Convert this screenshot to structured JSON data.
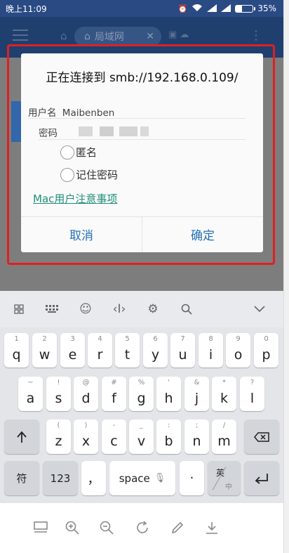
{
  "status_bar": {
    "time": "晚上11:09",
    "battery": "35%"
  },
  "app": {
    "tab_title": "局域网"
  },
  "dialog": {
    "title": "正在连接到 smb://192.168.0.109/",
    "username_label": "用户名",
    "username_value": "Maibenben",
    "password_label": "密码",
    "anonymous_label": "匿名",
    "remember_password_label": "记住密码",
    "mac_note_link": "Mac用户注意事项",
    "cancel_label": "取消",
    "confirm_label": "确定"
  },
  "keyboard": {
    "rows": [
      [
        {
          "main": "q",
          "hint": "1"
        },
        {
          "main": "w",
          "hint": "2"
        },
        {
          "main": "e",
          "hint": "3"
        },
        {
          "main": "r",
          "hint": "4"
        },
        {
          "main": "t",
          "hint": "5"
        },
        {
          "main": "y",
          "hint": "6"
        },
        {
          "main": "u",
          "hint": "7"
        },
        {
          "main": "i",
          "hint": "8"
        },
        {
          "main": "o",
          "hint": "9"
        },
        {
          "main": "p",
          "hint": "0"
        }
      ],
      [
        {
          "main": "a",
          "hint": "~"
        },
        {
          "main": "s",
          "hint": "!"
        },
        {
          "main": "d",
          "hint": "@"
        },
        {
          "main": "f",
          "hint": "#"
        },
        {
          "main": "g",
          "hint": "%"
        },
        {
          "main": "h",
          "hint": "'"
        },
        {
          "main": "j",
          "hint": "&"
        },
        {
          "main": "k",
          "hint": "*"
        },
        {
          "main": "l",
          "hint": "?"
        }
      ],
      [
        {
          "main": "z",
          "hint": "("
        },
        {
          "main": "x",
          "hint": ")"
        },
        {
          "main": "c",
          "hint": "-"
        },
        {
          "main": "v",
          "hint": "_"
        },
        {
          "main": "b",
          "hint": ":"
        },
        {
          "main": "n",
          "hint": ";"
        },
        {
          "main": "m",
          "hint": "/"
        }
      ]
    ],
    "symbols_label": "符",
    "numbers_label": "123",
    "comma_label": "，",
    "space_label": "space",
    "period_label": "·",
    "lang_top": "英",
    "lang_bottom": "中"
  }
}
